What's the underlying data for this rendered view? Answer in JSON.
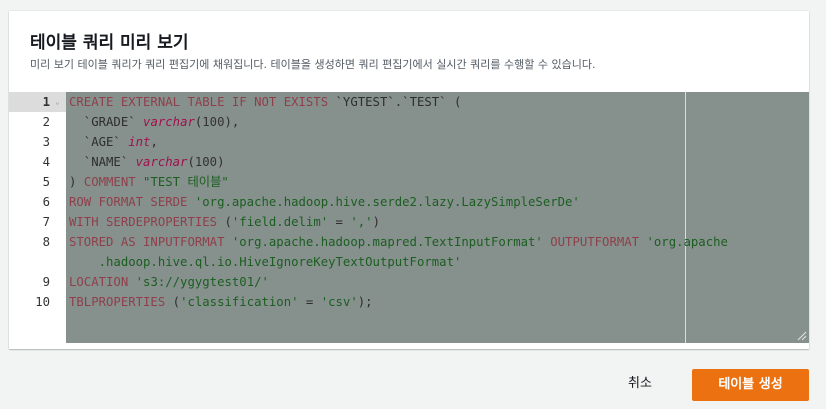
{
  "dialog": {
    "title": "테이블 쿼리 미리 보기",
    "description": "미리 보기 테이블 쿼리가 쿼리 편집기에 채워집니다. 테이블을 생성하면 쿼리 편집기에서 실시간 쿼리를 수행할 수 있습니다."
  },
  "editor": {
    "active_line": 1,
    "line_numbers": [
      "1",
      "2",
      "3",
      "4",
      "5",
      "6",
      "7",
      "8",
      "",
      "9",
      "10"
    ],
    "lines": [
      [
        [
          "kw",
          "CREATE EXTERNAL TABLE IF NOT EXISTS "
        ],
        [
          "id",
          "`YGTEST`.`TEST`"
        ],
        [
          "id",
          " ("
        ]
      ],
      [
        [
          "id",
          "  `GRADE` "
        ],
        [
          "ty",
          "varchar"
        ],
        [
          "id",
          "("
        ],
        [
          "num",
          "100"
        ],
        [
          "id",
          "),"
        ]
      ],
      [
        [
          "id",
          "  `AGE` "
        ],
        [
          "ty",
          "int"
        ],
        [
          "id",
          ","
        ]
      ],
      [
        [
          "id",
          "  `NAME` "
        ],
        [
          "ty",
          "varchar"
        ],
        [
          "id",
          "("
        ],
        [
          "num",
          "100"
        ],
        [
          "id",
          ")"
        ]
      ],
      [
        [
          "id",
          ") "
        ],
        [
          "kw",
          "COMMENT "
        ],
        [
          "str",
          "\"TEST 테이블\""
        ]
      ],
      [
        [
          "kw",
          "ROW FORMAT SERDE "
        ],
        [
          "str",
          "'org.apache.hadoop.hive.serde2.lazy.LazySimpleSerDe'"
        ]
      ],
      [
        [
          "kw",
          "WITH SERDEPROPERTIES "
        ],
        [
          "id",
          "("
        ],
        [
          "str",
          "'field.delim'"
        ],
        [
          "id",
          " = "
        ],
        [
          "str",
          "','"
        ],
        [
          "id",
          ")"
        ]
      ],
      [
        [
          "kw",
          "STORED AS INPUTFORMAT "
        ],
        [
          "str",
          "'org.apache.hadoop.mapred.TextInputFormat'"
        ],
        [
          "kw",
          " OUTPUTFORMAT "
        ],
        [
          "str",
          "'org.apache"
        ]
      ],
      [
        [
          "str",
          "    .hadoop.hive.ql.io.HiveIgnoreKeyTextOutputFormat'"
        ]
      ],
      [
        [
          "kw",
          "LOCATION "
        ],
        [
          "str",
          "'s3://ygygtest01/'"
        ]
      ],
      [
        [
          "kw",
          "TBLPROPERTIES "
        ],
        [
          "id",
          "("
        ],
        [
          "str",
          "'classification'"
        ],
        [
          "id",
          " = "
        ],
        [
          "str",
          "'csv'"
        ],
        [
          "id",
          ");"
        ]
      ]
    ]
  },
  "actions": {
    "cancel_label": "취소",
    "create_label": "테이블 생성"
  },
  "colors": {
    "accent": "#ec7211",
    "selection": "#86918e"
  }
}
